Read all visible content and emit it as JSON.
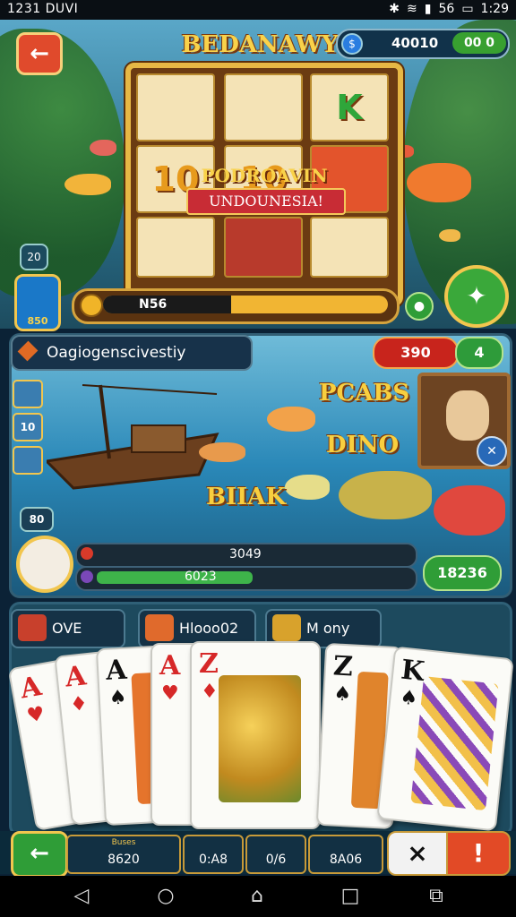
{
  "status_bar": {
    "left": "1231 DUVI",
    "right": "1:29",
    "signal_text": "56"
  },
  "header": {
    "back_icon": "←",
    "title": "BEDANAWY",
    "coin_value": "40010",
    "coin_button": "00 0"
  },
  "slot": {
    "cells": [
      "",
      "",
      "K",
      "10",
      "10",
      "",
      "",
      "",
      ""
    ],
    "banner_title": "PODROAVIN",
    "banner_sub": "UNDOUNESIA!",
    "left_badge": "20",
    "chest_label": "850",
    "progress_label": "N56",
    "progress": 0.45
  },
  "fishing": {
    "title": "Oagiogenscivestiy",
    "red_value": "390",
    "green_value": "4",
    "words": [
      "PCABS",
      "DINO",
      "BIIAK"
    ],
    "small_badge": "80",
    "row1_value": "3049",
    "row2_value": "6023",
    "row2_progress": 0.47,
    "score_button": "18236",
    "left_icons": [
      "",
      "10",
      ""
    ]
  },
  "cards_section": {
    "tabs": [
      {
        "label": "OVE"
      },
      {
        "label": "Hlooo02"
      },
      {
        "label": "M ony"
      }
    ],
    "cards": [
      {
        "rank": "A",
        "suit": "♥",
        "color": "#d62828"
      },
      {
        "rank": "A",
        "suit": "♦",
        "color": "#d62828"
      },
      {
        "rank": "A",
        "suit": "♠",
        "color": "#111111"
      },
      {
        "rank": "A",
        "suit": "♥",
        "color": "#d62828"
      },
      {
        "rank": "Z",
        "suit": "♦",
        "color": "#d62828"
      },
      {
        "rank": "Z",
        "suit": "♠",
        "color": "#111111"
      },
      {
        "rank": "K",
        "suit": "♠",
        "color": "#111111"
      }
    ]
  },
  "bottom_bar": {
    "back_icon": "←",
    "stats": [
      {
        "label": "8620",
        "caption": "Buses"
      },
      {
        "label": "0:A8",
        "caption": ""
      },
      {
        "label": "0/6",
        "caption": ""
      },
      {
        "label": "8A06",
        "caption": ""
      }
    ],
    "x_icon": "×",
    "alert_icon": "!"
  },
  "nav": {
    "back": "◁",
    "home": "○",
    "house": "⌂",
    "recent": "□",
    "tasks": "⧉"
  }
}
